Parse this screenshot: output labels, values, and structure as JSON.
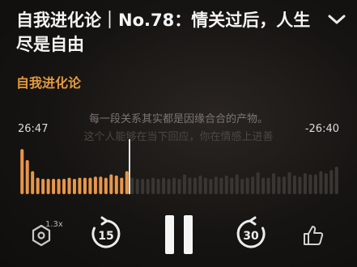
{
  "podcast": {
    "title": "自我进化论｜No.78：情关过后，人生尽是自由",
    "author": "自我进化论"
  },
  "lyrics": {
    "current": "每一段关系其实都是因缘合合的产物。",
    "next": "这个人能够在当下回应，你在情感上进善"
  },
  "player": {
    "elapsed": "26:47",
    "remaining": "-26:40",
    "progress": 0.5,
    "speed": "1.3x",
    "skip_back": "15",
    "skip_forward": "30"
  },
  "waveform": {
    "played_levels": [
      0.82,
      0.62,
      0.42,
      0.3,
      0.28,
      0.28,
      0.28,
      0.28,
      0.28,
      0.3,
      0.28,
      0.3,
      0.3,
      0.3,
      0.32,
      0.32,
      0.3,
      0.36,
      0.34,
      0.3,
      0.42
    ],
    "unplayed_levels": [
      0.3,
      0.28,
      0.28,
      0.28,
      0.3,
      0.28,
      0.3,
      0.28,
      0.3,
      0.28,
      0.36,
      0.3,
      0.3,
      0.34,
      0.3,
      0.28,
      0.32,
      0.3,
      0.34,
      0.3,
      0.36,
      0.28,
      0.3,
      0.32,
      0.4,
      0.3,
      0.3,
      0.38,
      0.32,
      0.32,
      0.4,
      0.34,
      0.32,
      0.38,
      0.36,
      0.36,
      0.42,
      0.38,
      0.44,
      0.5
    ],
    "played_color": "#e8964a",
    "unplayed_color": "#3a3633",
    "playhead_color": "#e6e6e6"
  },
  "icons": {
    "collapse": "chevron-down-icon",
    "speed": "hexagon-speed-icon",
    "back": "rewind-15-icon",
    "play": "pause-icon",
    "forward": "forward-30-icon",
    "like": "thumbs-up-icon"
  }
}
